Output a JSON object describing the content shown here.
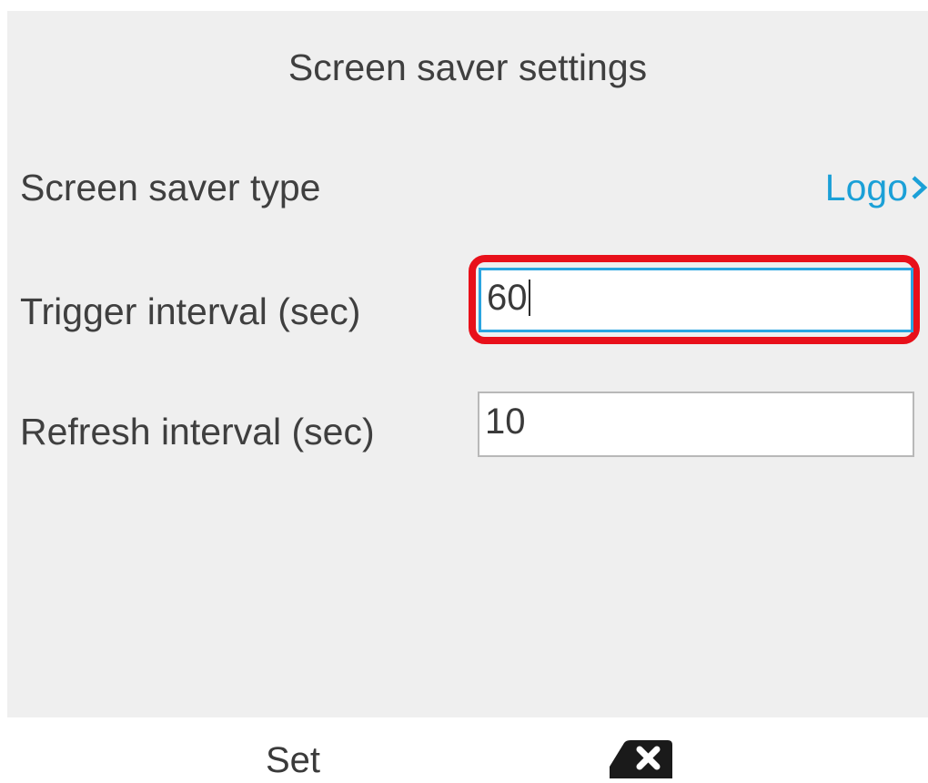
{
  "screen": {
    "title": "Screen saver settings"
  },
  "settings": {
    "type_label": "Screen saver type",
    "type_value": "Logo",
    "type_value_icon": "chevron-right-icon",
    "trigger_label": "Trigger interval (sec)",
    "trigger_value": "60",
    "refresh_label": "Refresh interval (sec)",
    "refresh_value": "10"
  },
  "softkeys": {
    "set_label": "Set",
    "backspace_icon": "backspace-icon"
  },
  "colors": {
    "accent": "#1ba0d7",
    "highlight": "#e8101a",
    "background": "#efefef",
    "text": "#3f3f3f"
  }
}
